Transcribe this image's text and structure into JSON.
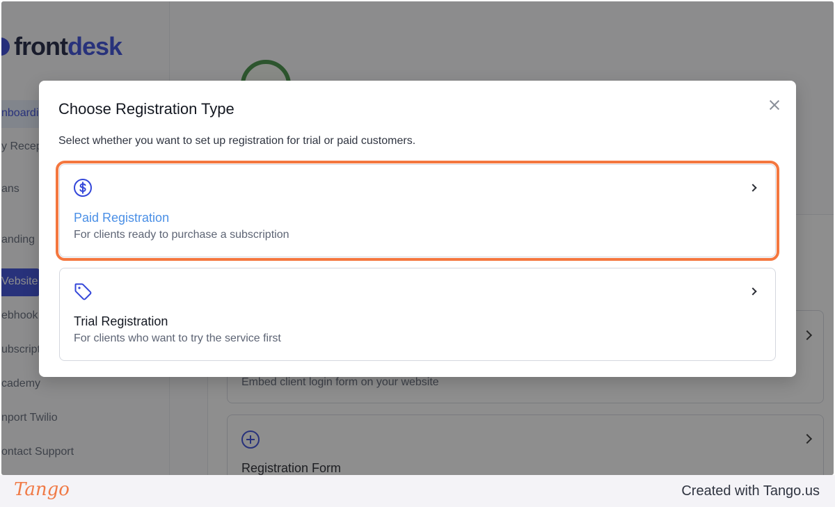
{
  "app": {
    "logo_text_a": "front",
    "logo_text_b": "desk"
  },
  "sidebar": {
    "items": [
      {
        "label": "nboardi",
        "state": "highlighted"
      },
      {
        "label": "y Recep",
        "state": "normal"
      },
      {
        "label": "ans",
        "state": "normal"
      },
      {
        "label": "anding",
        "state": "normal"
      },
      {
        "label": "Vebsite",
        "state": "active"
      },
      {
        "label": "ebhook",
        "state": "normal"
      },
      {
        "label": "ubscript",
        "state": "normal"
      },
      {
        "label": "cademy",
        "state": "normal"
      },
      {
        "label": "nport Twilio",
        "state": "normal"
      },
      {
        "label": "ontact Support",
        "state": "normal"
      }
    ]
  },
  "background_cards": [
    {
      "description": "Embed client login form on your website"
    },
    {
      "title": "Registration Form",
      "icon": "plus-circle-icon"
    }
  ],
  "modal": {
    "title": "Choose Registration Type",
    "description": "Select whether you want to set up registration for trial or paid customers.",
    "options": [
      {
        "title": "Paid Registration",
        "description": "For clients ready to purchase a subscription",
        "icon": "dollar-circle-icon",
        "highlighted": true
      },
      {
        "title": "Trial Registration",
        "description": "For clients who want to try the service first",
        "icon": "tag-icon",
        "highlighted": false
      }
    ]
  },
  "footer": {
    "logo": "Tango",
    "credit": "Created with Tango.us"
  },
  "colors": {
    "brand_blue": "#3346d9",
    "highlight_orange": "#f4773f",
    "paid_title": "#4a8fe6"
  }
}
